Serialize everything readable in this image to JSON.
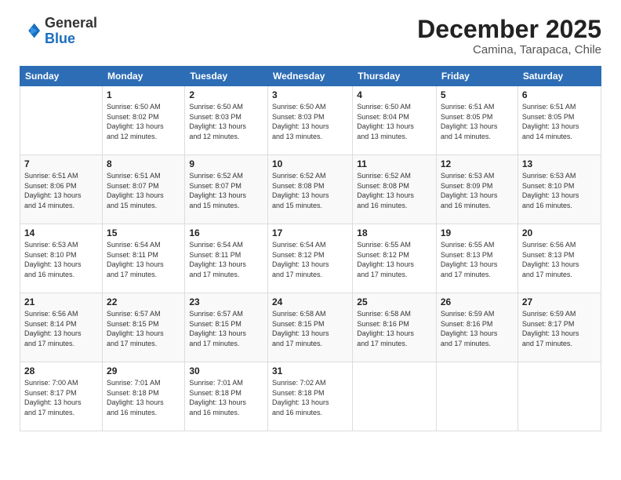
{
  "logo": {
    "general": "General",
    "blue": "Blue"
  },
  "title": "December 2025",
  "subtitle": "Camina, Tarapaca, Chile",
  "days_header": [
    "Sunday",
    "Monday",
    "Tuesday",
    "Wednesday",
    "Thursday",
    "Friday",
    "Saturday"
  ],
  "weeks": [
    [
      {
        "num": "",
        "info": ""
      },
      {
        "num": "1",
        "info": "Sunrise: 6:50 AM\nSunset: 8:02 PM\nDaylight: 13 hours\nand 12 minutes."
      },
      {
        "num": "2",
        "info": "Sunrise: 6:50 AM\nSunset: 8:03 PM\nDaylight: 13 hours\nand 12 minutes."
      },
      {
        "num": "3",
        "info": "Sunrise: 6:50 AM\nSunset: 8:03 PM\nDaylight: 13 hours\nand 13 minutes."
      },
      {
        "num": "4",
        "info": "Sunrise: 6:50 AM\nSunset: 8:04 PM\nDaylight: 13 hours\nand 13 minutes."
      },
      {
        "num": "5",
        "info": "Sunrise: 6:51 AM\nSunset: 8:05 PM\nDaylight: 13 hours\nand 14 minutes."
      },
      {
        "num": "6",
        "info": "Sunrise: 6:51 AM\nSunset: 8:05 PM\nDaylight: 13 hours\nand 14 minutes."
      }
    ],
    [
      {
        "num": "7",
        "info": "Sunrise: 6:51 AM\nSunset: 8:06 PM\nDaylight: 13 hours\nand 14 minutes."
      },
      {
        "num": "8",
        "info": "Sunrise: 6:51 AM\nSunset: 8:07 PM\nDaylight: 13 hours\nand 15 minutes."
      },
      {
        "num": "9",
        "info": "Sunrise: 6:52 AM\nSunset: 8:07 PM\nDaylight: 13 hours\nand 15 minutes."
      },
      {
        "num": "10",
        "info": "Sunrise: 6:52 AM\nSunset: 8:08 PM\nDaylight: 13 hours\nand 15 minutes."
      },
      {
        "num": "11",
        "info": "Sunrise: 6:52 AM\nSunset: 8:08 PM\nDaylight: 13 hours\nand 16 minutes."
      },
      {
        "num": "12",
        "info": "Sunrise: 6:53 AM\nSunset: 8:09 PM\nDaylight: 13 hours\nand 16 minutes."
      },
      {
        "num": "13",
        "info": "Sunrise: 6:53 AM\nSunset: 8:10 PM\nDaylight: 13 hours\nand 16 minutes."
      }
    ],
    [
      {
        "num": "14",
        "info": "Sunrise: 6:53 AM\nSunset: 8:10 PM\nDaylight: 13 hours\nand 16 minutes."
      },
      {
        "num": "15",
        "info": "Sunrise: 6:54 AM\nSunset: 8:11 PM\nDaylight: 13 hours\nand 17 minutes."
      },
      {
        "num": "16",
        "info": "Sunrise: 6:54 AM\nSunset: 8:11 PM\nDaylight: 13 hours\nand 17 minutes."
      },
      {
        "num": "17",
        "info": "Sunrise: 6:54 AM\nSunset: 8:12 PM\nDaylight: 13 hours\nand 17 minutes."
      },
      {
        "num": "18",
        "info": "Sunrise: 6:55 AM\nSunset: 8:12 PM\nDaylight: 13 hours\nand 17 minutes."
      },
      {
        "num": "19",
        "info": "Sunrise: 6:55 AM\nSunset: 8:13 PM\nDaylight: 13 hours\nand 17 minutes."
      },
      {
        "num": "20",
        "info": "Sunrise: 6:56 AM\nSunset: 8:13 PM\nDaylight: 13 hours\nand 17 minutes."
      }
    ],
    [
      {
        "num": "21",
        "info": "Sunrise: 6:56 AM\nSunset: 8:14 PM\nDaylight: 13 hours\nand 17 minutes."
      },
      {
        "num": "22",
        "info": "Sunrise: 6:57 AM\nSunset: 8:15 PM\nDaylight: 13 hours\nand 17 minutes."
      },
      {
        "num": "23",
        "info": "Sunrise: 6:57 AM\nSunset: 8:15 PM\nDaylight: 13 hours\nand 17 minutes."
      },
      {
        "num": "24",
        "info": "Sunrise: 6:58 AM\nSunset: 8:15 PM\nDaylight: 13 hours\nand 17 minutes."
      },
      {
        "num": "25",
        "info": "Sunrise: 6:58 AM\nSunset: 8:16 PM\nDaylight: 13 hours\nand 17 minutes."
      },
      {
        "num": "26",
        "info": "Sunrise: 6:59 AM\nSunset: 8:16 PM\nDaylight: 13 hours\nand 17 minutes."
      },
      {
        "num": "27",
        "info": "Sunrise: 6:59 AM\nSunset: 8:17 PM\nDaylight: 13 hours\nand 17 minutes."
      }
    ],
    [
      {
        "num": "28",
        "info": "Sunrise: 7:00 AM\nSunset: 8:17 PM\nDaylight: 13 hours\nand 17 minutes."
      },
      {
        "num": "29",
        "info": "Sunrise: 7:01 AM\nSunset: 8:18 PM\nDaylight: 13 hours\nand 16 minutes."
      },
      {
        "num": "30",
        "info": "Sunrise: 7:01 AM\nSunset: 8:18 PM\nDaylight: 13 hours\nand 16 minutes."
      },
      {
        "num": "31",
        "info": "Sunrise: 7:02 AM\nSunset: 8:18 PM\nDaylight: 13 hours\nand 16 minutes."
      },
      {
        "num": "",
        "info": ""
      },
      {
        "num": "",
        "info": ""
      },
      {
        "num": "",
        "info": ""
      }
    ]
  ]
}
